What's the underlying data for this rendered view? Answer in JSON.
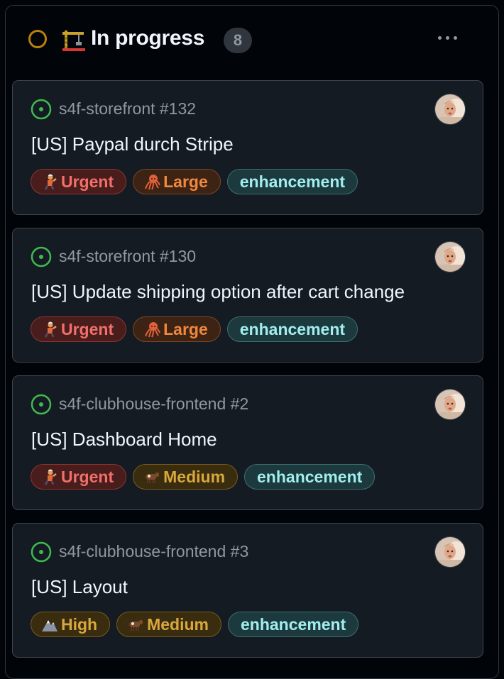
{
  "column": {
    "title": "In progress",
    "count": "8",
    "status_color": "#bb8009",
    "icon": "building-construction-icon",
    "more_icon": "kebab-horizontal-icon"
  },
  "cards": [
    {
      "repo_ref": "s4f-storefront #132",
      "title": "[US] Paypal durch Stripe",
      "labels": [
        {
          "text": "Urgent",
          "icon": "rescue-worker-icon"
        },
        {
          "text": "Large",
          "icon": "octopus-icon"
        },
        {
          "text": "enhancement",
          "icon": ""
        }
      ]
    },
    {
      "repo_ref": "s4f-storefront #130",
      "title": "[US] Update shipping option after cart change",
      "labels": [
        {
          "text": "Urgent",
          "icon": "rescue-worker-icon"
        },
        {
          "text": "Large",
          "icon": "octopus-icon"
        },
        {
          "text": "enhancement",
          "icon": ""
        }
      ]
    },
    {
      "repo_ref": "s4f-clubhouse-frontend #2",
      "title": "[US] Dashboard Home",
      "labels": [
        {
          "text": "Urgent",
          "icon": "rescue-worker-icon"
        },
        {
          "text": "Medium",
          "icon": "cow-icon"
        },
        {
          "text": "enhancement",
          "icon": ""
        }
      ]
    },
    {
      "repo_ref": "s4f-clubhouse-frontend #3",
      "title": "[US] Layout",
      "labels": [
        {
          "text": "High",
          "icon": "mountain-icon"
        },
        {
          "text": "Medium",
          "icon": "cow-icon"
        },
        {
          "text": "enhancement",
          "icon": ""
        }
      ]
    }
  ],
  "colors": {
    "open_issue": "#3fb950",
    "urgent": "#f0706a",
    "large": "#f0883e",
    "medium": "#d7a83e",
    "high": "#d7a83e",
    "enhancement": "#a2eeef"
  }
}
